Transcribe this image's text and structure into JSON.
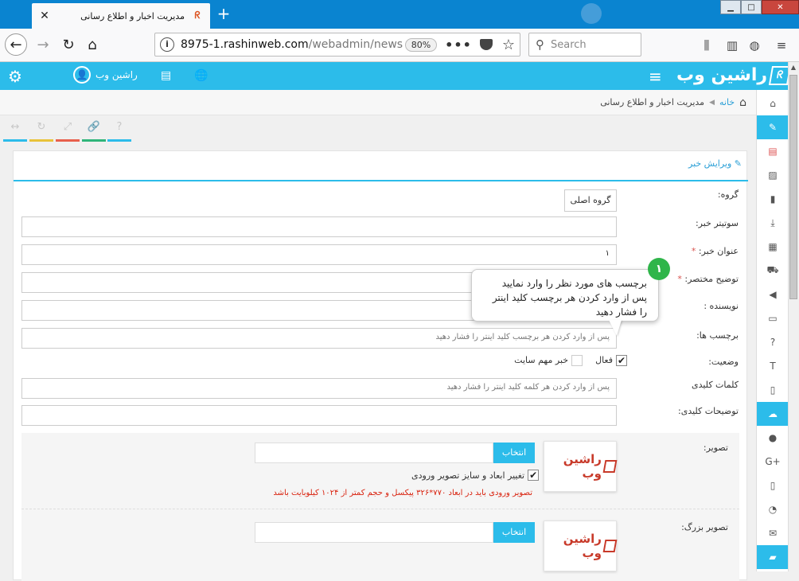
{
  "browser": {
    "tab_title": "مدیریت اخبار و اطلاع رسانی",
    "url_host": "8975-1.rashinweb.com",
    "url_path": "/webadmin/news",
    "zoom": "80%",
    "search_placeholder": "Search"
  },
  "header": {
    "user_name": "راشین وب",
    "logo_text": "راشین وب"
  },
  "breadcrumb": {
    "home": "خانه",
    "current": "مدیریت اخبار و اطلاع رسانی"
  },
  "toolbar": {
    "bar_colors": [
      "#2cbcea",
      "#e9c33a",
      "#e8604d",
      "#2fb57a",
      "#2cbcea"
    ]
  },
  "panel": {
    "title": "ویرایش خبر"
  },
  "form": {
    "group_label": "گروه:",
    "group_value": "گروه اصلی",
    "subtitle_label": "سوتیتر خبر:",
    "title_label": "عنوان خبر:",
    "title_value": "۱",
    "summary_label": "توضیح مختصر:",
    "author_label": "نویسنده :",
    "tags_label": "برچسب ها:",
    "tags_placeholder": "پس از وارد کردن هر برچسب کلید اینتر را فشار دهید",
    "status_label": "وضعیت:",
    "active_label": "فعال",
    "important_label": "خبر مهم سایت",
    "keywords_label": "کلمات کلیدی",
    "keywords_placeholder": "پس از وارد کردن هر کلمه کلید اینتر را فشار دهید",
    "keydesc_label": "توضیحات کلیدی:",
    "image_label": "تصویر:",
    "pick_label": "انتخاب",
    "resize_label": "تغییر ابعاد و سایز تصویر ورودی",
    "image_warning": "تصویر ورودی باید در ابعاد ۷۷۰*۳۲۶ پیکسل و حجم کمتر از ۱۰۲۴ کیلوبایت باشد",
    "big_image_label": "تصویر بزرگ:",
    "pick_label_2": "انتخاب",
    "thumb_brand": "راشین وب"
  },
  "tooltip": {
    "badge": "۱",
    "line1": "برچسب های مورد نظر را وارد نمایید",
    "line2": "پس از وارد کردن هر برچسب کلید اینتر",
    "line3": "را فشار دهید"
  }
}
